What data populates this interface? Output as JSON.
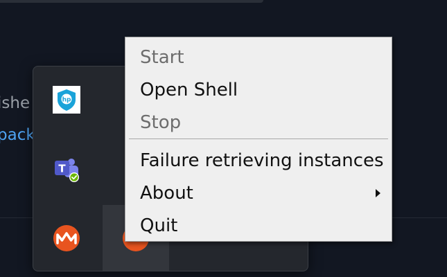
{
  "background": {
    "text_line_1": "ishe",
    "text_line_2": "pack"
  },
  "tray": {
    "icons": [
      {
        "name": "hp-security-icon"
      },
      {
        "name": "teams-icon"
      },
      {
        "name": "orange-app-icon"
      },
      {
        "name": "rancher-app-icon"
      }
    ]
  },
  "menu": {
    "start_label": "Start",
    "open_shell_label": "Open Shell",
    "stop_label": "Stop",
    "failure_label": "Failure retrieving instances",
    "about_label": "About",
    "quit_label": "Quit"
  },
  "colors": {
    "desktop_bg": "#121722",
    "tray_bg": "#24272d",
    "menu_bg": "#efefef",
    "menu_text": "#111111",
    "menu_disabled_text": "#6d6d6d",
    "link_blue": "#4ea3f2",
    "orange_accent": "#e8541f"
  }
}
